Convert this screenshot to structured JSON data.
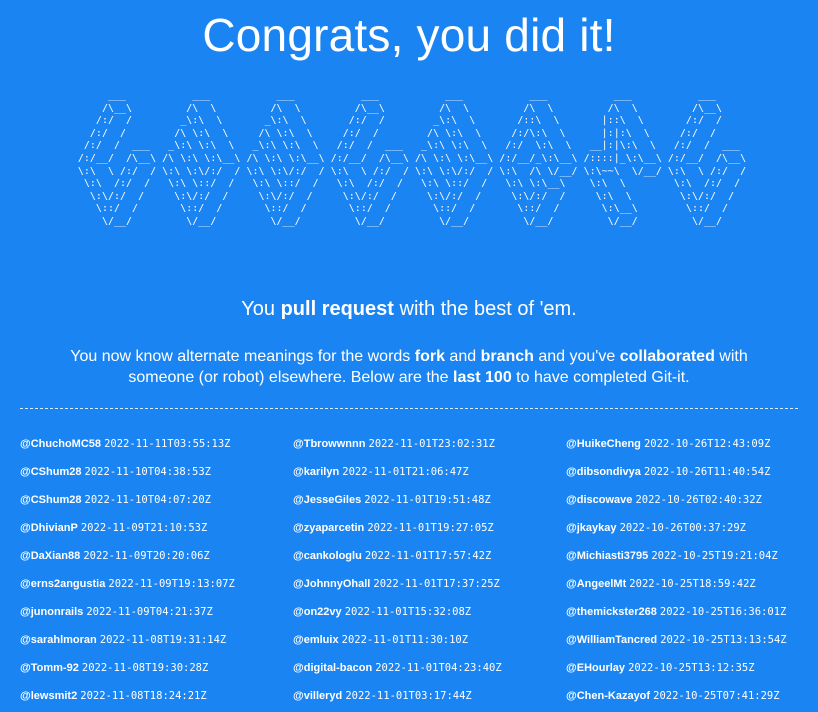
{
  "page": {
    "title": "Congrats, you did it!",
    "ascii_art": "      ___           ___           ___           ___           ___           ___           ___           ___     \n     /\\__\\         /\\  \\         /\\  \\         /\\__\\         /\\  \\         /\\  \\         /\\  \\         /\\__\\    \n    /:/  /        _\\:\\  \\       _\\:\\  \\       /:/  /        _\\:\\  \\       /::\\  \\       |::\\  \\       /:/  /    \n   /:/  /        /\\ \\:\\  \\     /\\ \\:\\  \\     /:/  /        /\\ \\:\\  \\     /:/\\:\\  \\      |:|:\\  \\     /:/  /     \n  /:/  /  ___   _\\:\\ \\:\\  \\   _\\:\\ \\:\\  \\   /:/  /  ___   _\\:\\ \\:\\  \\   /:/  \\:\\  \\   __|:|\\:\\  \\   /:/  /  ___ \n /:/__/  /\\__\\ /\\ \\:\\ \\:\\__\\ /\\ \\:\\ \\:\\__\\ /:/__/  /\\__\\ /\\ \\:\\ \\:\\__\\ /:/__/_\\:\\__\\ /::::|_\\:\\__\\ /:/__/  /\\__\\\n \\:\\  \\ /:/  / \\:\\ \\:\\/:/  / \\:\\ \\:\\/:/  / \\:\\  \\ /:/  / \\:\\ \\:\\/:/  / \\:\\  /\\ \\/__/ \\:\\~~\\  \\/__/ \\:\\  \\ /:/  /\n  \\:\\  /:/  /   \\:\\ \\::/  /   \\:\\ \\::/  /   \\:\\  /:/  /   \\:\\ \\::/  /   \\:\\ \\:\\__\\    \\:\\  \\        \\:\\  /:/  / \n   \\:\\/:/  /     \\:\\/:/  /     \\:\\/:/  /     \\:\\/:/  /     \\:\\/:/  /     \\:\\/:/  /     \\:\\  \\        \\:\\/:/  /  \n    \\::/  /       \\::/  /       \\::/  /       \\::/  /       \\::/  /       \\::/  /       \\:\\__\\        \\::/  /   \n     \\/__/         \\/__/         \\/__/         \\/__/         \\/__/         \\/__/         \\/__/         \\/__/    ",
    "tagline": {
      "pre": "You ",
      "bold": "pull request",
      "post": " with the best of 'em."
    },
    "description": {
      "t1": "You now know alternate meanings for the words ",
      "b1": "fork",
      "t2": " and ",
      "b2": "branch",
      "t3": " and you've ",
      "b3": "collaborated",
      "t4": " with someone (or robot) elsewhere. Below are the ",
      "b4": "last 100",
      "t5": " to have completed Git-it."
    }
  },
  "completions": {
    "col1": [
      {
        "user": "@ChuchoMC58",
        "time": "2022-11-11T03:55:13Z"
      },
      {
        "user": "@CShum28",
        "time": "2022-11-10T04:38:53Z"
      },
      {
        "user": "@CShum28",
        "time": "2022-11-10T04:07:20Z"
      },
      {
        "user": "@DhivianP",
        "time": "2022-11-09T21:10:53Z"
      },
      {
        "user": "@DaXian88",
        "time": "2022-11-09T20:20:06Z"
      },
      {
        "user": "@erns2angustia",
        "time": "2022-11-09T19:13:07Z"
      },
      {
        "user": "@junonrails",
        "time": "2022-11-09T04:21:37Z"
      },
      {
        "user": "@sarahlmoran",
        "time": "2022-11-08T19:31:14Z"
      },
      {
        "user": "@Tomm-92",
        "time": "2022-11-08T19:30:28Z"
      },
      {
        "user": "@lewsmit2",
        "time": "2022-11-08T18:24:21Z"
      }
    ],
    "col2": [
      {
        "user": "@Tbrowwnnn",
        "time": "2022-11-01T23:02:31Z"
      },
      {
        "user": "@karilyn",
        "time": "2022-11-01T21:06:47Z"
      },
      {
        "user": "@JesseGiles",
        "time": "2022-11-01T19:51:48Z"
      },
      {
        "user": "@zyaparcetin",
        "time": "2022-11-01T19:27:05Z"
      },
      {
        "user": "@cankologlu",
        "time": "2022-11-01T17:57:42Z"
      },
      {
        "user": "@JohnnyOhall",
        "time": "2022-11-01T17:37:25Z"
      },
      {
        "user": "@on22vy",
        "time": "2022-11-01T15:32:08Z"
      },
      {
        "user": "@emluix",
        "time": "2022-11-01T11:30:10Z"
      },
      {
        "user": "@digital-bacon",
        "time": "2022-11-01T04:23:40Z"
      },
      {
        "user": "@villeryd",
        "time": "2022-11-01T03:17:44Z"
      }
    ],
    "col3": [
      {
        "user": "@HuikeCheng",
        "time": "2022-10-26T12:43:09Z"
      },
      {
        "user": "@dibsondivya",
        "time": "2022-10-26T11:40:54Z"
      },
      {
        "user": "@discowave",
        "time": "2022-10-26T02:40:32Z"
      },
      {
        "user": "@jkaykay",
        "time": "2022-10-26T00:37:29Z"
      },
      {
        "user": "@Michiasti3795",
        "time": "2022-10-25T19:21:04Z"
      },
      {
        "user": "@AngeelMt",
        "time": "2022-10-25T18:59:42Z"
      },
      {
        "user": "@themickster268",
        "time": "2022-10-25T16:36:01Z"
      },
      {
        "user": "@WilliamTancred",
        "time": "2022-10-25T13:13:54Z"
      },
      {
        "user": "@EHourlay",
        "time": "2022-10-25T13:12:35Z"
      },
      {
        "user": "@Chen-Kazayof",
        "time": "2022-10-25T07:41:29Z"
      }
    ]
  },
  "colors": {
    "background": "#1a84f2",
    "text": "#ffffff"
  }
}
